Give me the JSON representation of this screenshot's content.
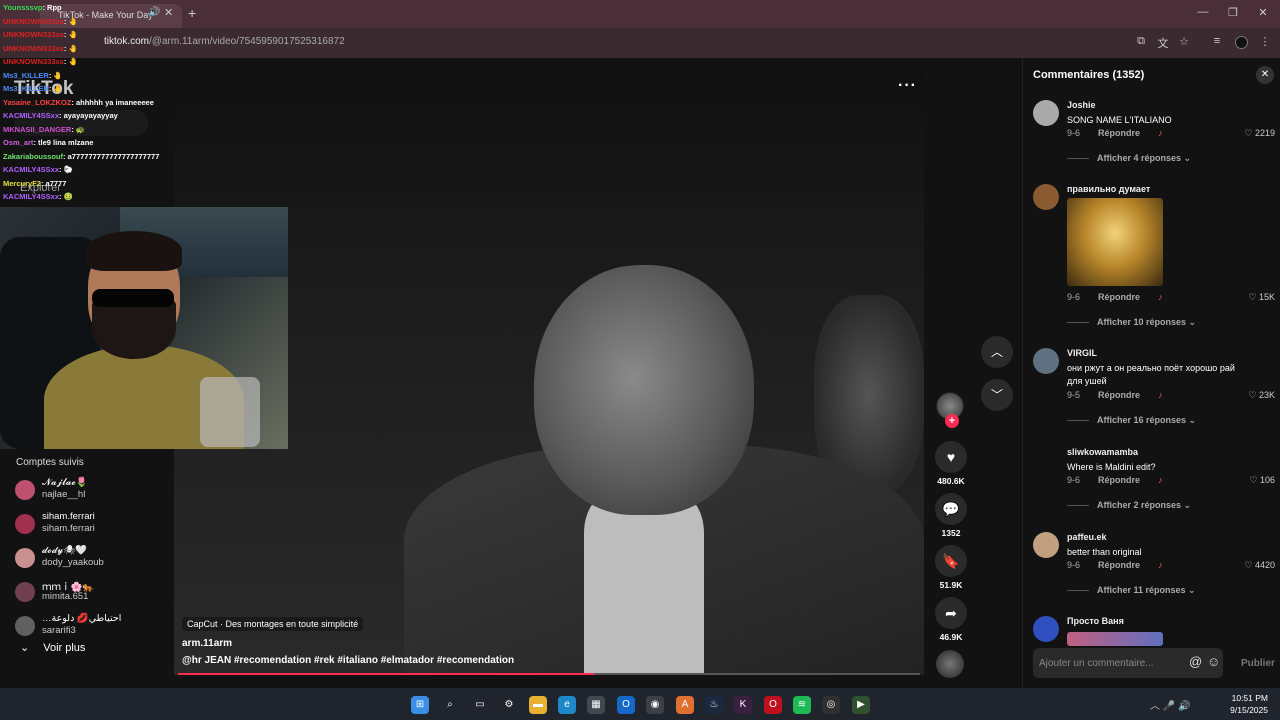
{
  "browser": {
    "tab_title": "TikTok - Make Your Day",
    "url_domain": "tiktok.com",
    "url_path": "/@arm.11arm/video/7545959017525316872"
  },
  "sidebar": {
    "logo": "TikTok",
    "explore": "Explorer",
    "followed_title": "Comptes suivis",
    "followed": [
      {
        "display": "𝓝𝓪𝓳𝓵𝓪𝓮🌷",
        "handle": "najlae__hl",
        "color": "#c05070"
      },
      {
        "display": "siham.ferrari",
        "handle": "siham.ferrari",
        "color": "#a03050"
      },
      {
        "display": "𝓭𝓸𝓭𝔂🕷🤍",
        "handle": "dody_yaakoub",
        "color": "#c89090"
      },
      {
        "display": "ｍｍｉ🌸🐅",
        "handle": "mimita.651",
        "color": "#704050"
      },
      {
        "display": "…احتياطي💋 دلوعة",
        "handle": "sararifi3",
        "color": "#606060"
      }
    ],
    "see_more": "Voir plus"
  },
  "chat": [
    {
      "user": "Younsssvp",
      "msg": ": Rpp",
      "color": "#33dd55"
    },
    {
      "user": "UNKNOWN333xs",
      "msg": ": 🤚",
      "color": "#e02020"
    },
    {
      "user": "UNKNOWN333xs",
      "msg": ": 🤚",
      "color": "#e02020"
    },
    {
      "user": "UNKNOWN333xs",
      "msg": ": 🤚",
      "color": "#e02020"
    },
    {
      "user": "UNKNOWN333xs",
      "msg": ": 🤚",
      "color": "#e02020"
    },
    {
      "user": "Ms3_KILLER",
      "msg": ": 🤚",
      "color": "#4a8cff"
    },
    {
      "user": "Ms3_KILLER",
      "msg": ": 🤚",
      "color": "#4a8cff"
    },
    {
      "user": "Yasaine_LOKZKOZ",
      "msg": ": ahhhhh ya imaneeeee",
      "color": "#ff4040"
    },
    {
      "user": "KACMILY4SSxx",
      "msg": ": ayayayayayyay",
      "color": "#b060ff"
    },
    {
      "user": "MKNASII_DANGER",
      "msg": ": 🐢",
      "color": "#d050d0"
    },
    {
      "user": "Osm_art",
      "msg": ": tle9 lina mlzane",
      "color": "#d060e0"
    },
    {
      "user": "Zakariaboussouf",
      "msg": ": a777777777777777777777",
      "color": "#70e070"
    },
    {
      "user": "KACMILY4SSxx",
      "msg": ": 🐑",
      "color": "#b060ff"
    },
    {
      "user": "MercuryF2",
      "msg": ": a7777",
      "color": "#e0e040"
    },
    {
      "user": "KACMILY4SSxx",
      "msg": ": 🤢",
      "color": "#b060ff"
    }
  ],
  "video": {
    "author": "arm.11arm",
    "caption": "@hr JEAN  #recomendation  #rek  #italiano  #elmatador  #recomendation",
    "capcut": "CapCut · Des montages en toute simplicité",
    "progress": 0.56,
    "likes": "480.6K",
    "comments": "1352",
    "saves": "51.9K",
    "shares": "46.9K"
  },
  "comments": {
    "title": "Commentaires (1352)",
    "input_placeholder": "Ajouter un commentaire...",
    "publish": "Publier",
    "reply_label": "Répondre",
    "items": [
      {
        "user": "Joshie",
        "text": "SONG NAME L'ITALIANO",
        "date": "9-6",
        "likes": "2219",
        "more": "Afficher 4 réponses",
        "color": "#aaaaaa"
      },
      {
        "user": "правильно думает",
        "text": "",
        "date": "9-6",
        "likes": "15K",
        "more": "Afficher 10 réponses",
        "color": "#8a5a30"
      },
      {
        "user": "VIRGIL",
        "text": "они ржут а он реально поёт хорошо рай для ушей",
        "date": "9-5",
        "likes": "23K",
        "more": "Afficher 16 réponses",
        "color": "#607080"
      },
      {
        "user": "sliwkowamamba",
        "text": "Where is Maldini edit?",
        "date": "9-6",
        "likes": "106",
        "more": "Afficher 2 réponses",
        "color": "#111111"
      },
      {
        "user": "paffeu.ek",
        "text": "better than original",
        "date": "9-6",
        "likes": "4420",
        "more": "Afficher 11 réponses",
        "color": "#c0a080"
      },
      {
        "user": "Просто Ваня",
        "text": "",
        "date": "",
        "likes": "",
        "more": "",
        "color": "#3050c0"
      }
    ]
  },
  "taskbar": {
    "time": "10:51 PM",
    "date": "9/15/2025"
  }
}
